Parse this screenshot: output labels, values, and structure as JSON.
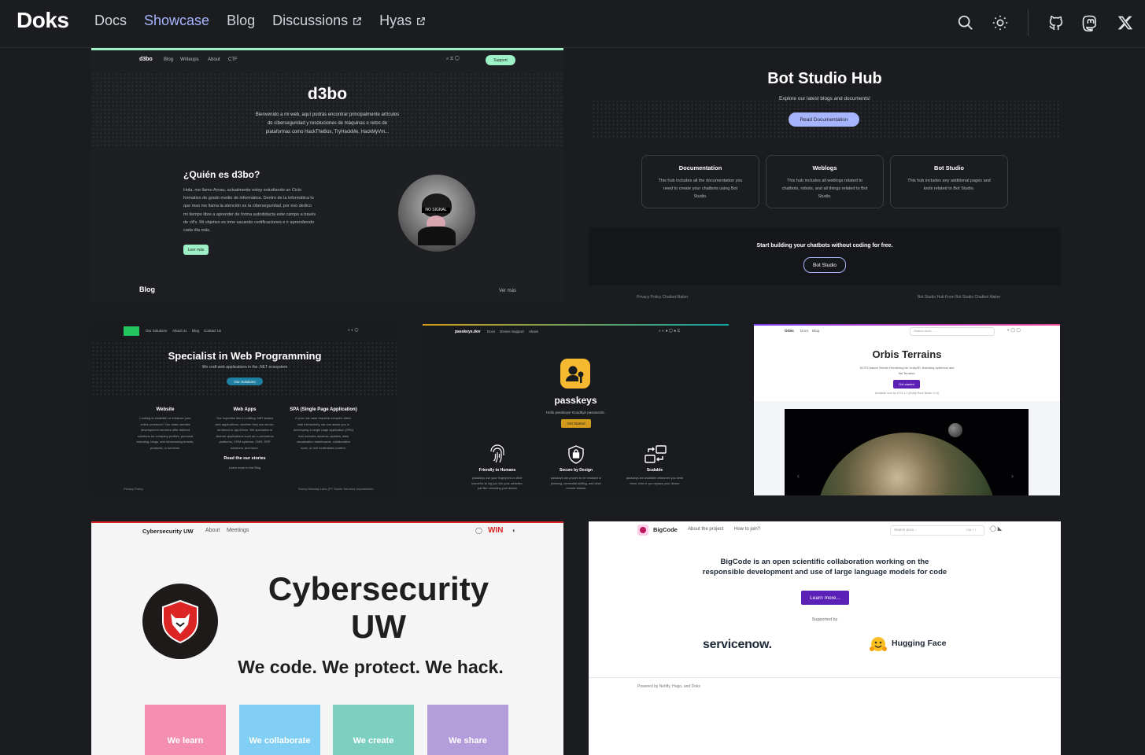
{
  "header": {
    "brand": "Doks",
    "nav": [
      {
        "label": "Docs"
      },
      {
        "label": "Showcase"
      },
      {
        "label": "Blog"
      },
      {
        "label": "Discussions"
      },
      {
        "label": "Hyas"
      }
    ]
  },
  "d3bo": {
    "nav_brand": "d3bo",
    "nav_links": [
      "Blog",
      "Writeups",
      "About",
      "CTF"
    ],
    "support": "Support",
    "title": "d3bo",
    "intro": [
      "Bienvenido a mi web, aquí podrás encontrar principalmente artículos",
      "de ciberseguridad y resoluciones de máquinas o retos de",
      "plataformas como HackTheBox, TryHackMe, HackMyVm..."
    ],
    "about_title": "¿Quién es d3bo?",
    "about_text": [
      "Hola, me llamo Arnau, actualmente estoy estudiando un Ciclo",
      "formativo de grado medio de informática. Dentro de la informática lo",
      "que mas me llama la atención es la ciberseguridad, por eso dedico",
      "mi tiempo libre a aprender de forma autodidacta este campo a través",
      "de ctf's. Mi objetivo es irme sacando certificaciones e ir aprendiendo",
      "cada día más."
    ],
    "read_more": "Leer más",
    "blog": "Blog",
    "see_more": "Ver más"
  },
  "botstudio": {
    "title": "Bot Studio Hub",
    "subtitle": "Explore our latest blogs and documents!",
    "cta": "Read Documentation",
    "cards": [
      {
        "title": "Documentation",
        "text": [
          "This hub includes all the documentation you",
          "need to create your chatbots using Bot",
          "Studio."
        ]
      },
      {
        "title": "Weblogs",
        "text": [
          "This hub includes all weblogs related to",
          "chatbots, robots, and all things related to Bot",
          "Studio."
        ]
      },
      {
        "title": "Bot Studio",
        "text": [
          "This hub includes any additional pages and",
          "tools related to Bot Studio."
        ]
      }
    ],
    "banner": "Start building your chatbots without coding for free.",
    "banner_btn": "Bot Studio",
    "footer_left": "Privacy Policy    Chatbot Maker",
    "footer_right": "Bot Studio Hub From Bot Studio Chatbot Maker"
  },
  "webprog": {
    "nav_links": [
      "Our Solutions",
      "About Us",
      "Blog",
      "Contact Us"
    ],
    "title": "Specialist in Web Programming",
    "subtitle": "We craft web applications in the .NET ecosystem",
    "cta": "Our Solutions",
    "cols": [
      {
        "title": "Website",
        "text": [
          "Looking to establish or enhance your",
          "online presence? Our static website",
          "development services offer tailored",
          "solutions for company profiles, personal",
          "branding, blogs, and showcasing brands,",
          "products, or services."
        ]
      },
      {
        "title": "Web Apps",
        "text": [
          "Our expertise lies in crafting .NET-based",
          "web applications, whether they are server-",
          "rendered or api-driven. We specialize in",
          "diverse applications such as e-commerce",
          "platforms, CRM systems, CMS, ERP",
          "solutions, and more."
        ]
      },
      {
        "title": "SPA (Single Page Application)",
        "text": [
          "If your use case requires complex client-",
          "side interactivity, we can assist you in",
          "developing a single page application (SPA)",
          "that includes dynamic updates, data",
          "visualization dashboards, collaborative",
          "tools, or rich multimedia content."
        ]
      }
    ],
    "stories": "Read the our stories",
    "stories_sub": "Learn more in the Blog",
    "privacy": "Privacy Policy",
    "copyright": "Sunny Monday Labs (PT Sumin Service) Unpublished"
  },
  "passkeys": {
    "brand": "passkeys.dev",
    "nav_links": [
      "Docs",
      "Device Support",
      "About"
    ],
    "title": "passkeys",
    "subtitle": "Hello passkeys! Goodbye passwords.",
    "cta": "Get Started",
    "features": [
      {
        "title": "Friendly to Humans",
        "text": [
          "passkeys use your fingerprint or other",
          "biometric to log you into your websites,",
          "just like unlocking your device"
        ]
      },
      {
        "title": "Secure by Design",
        "text": [
          "passkeys are proven to be resistant to",
          "phishing, credential stuffing, and other",
          "remote attacks"
        ]
      },
      {
        "title": "Scalable",
        "text": [
          "passkeys are available whenever you need",
          "them, even if you replace your device"
        ]
      }
    ]
  },
  "orbis": {
    "nav_links": [
      "Orbis",
      "Docs",
      "Blog"
    ],
    "search": "Search docs...",
    "title": "Orbis Terrains",
    "subtitle": [
      "DOTS based Terrain Rendering for Unity3D, featuring spherical and",
      "flat Terrains."
    ],
    "cta": "Get started",
    "note": "Available now for ECS 1.0 (Entity Rock Beam v1.0)"
  },
  "cyber": {
    "brand": "Cybersecurity UW",
    "nav_links": [
      "About",
      "Meetings"
    ],
    "win": "WIN",
    "title_line1": "Cybersecurity",
    "title_line2": "UW",
    "tagline": "We code. We protect. We hack.",
    "tiles": [
      {
        "label": "We learn",
        "color": "#f48fb1"
      },
      {
        "label": "We collaborate",
        "color": "#81cff5"
      },
      {
        "label": "We create",
        "color": "#7dcfc0"
      },
      {
        "label": "We share",
        "color": "#b39ddb"
      }
    ]
  },
  "bigcode": {
    "brand": "BigCode",
    "nav_links": [
      "About the project",
      "How to join?"
    ],
    "search": "Search docs...",
    "shortcut": "Ctrl + /",
    "headline_1": "BigCode is an open scientific collaboration working on the",
    "headline_2": "responsible development and use of large language models for code",
    "cta": "Learn more...",
    "supported": "Supported by",
    "sponsor_1": "servicenow.",
    "sponsor_2": "Hugging Face",
    "footer": "Powered by Netlify, Hugo, and Doks"
  }
}
